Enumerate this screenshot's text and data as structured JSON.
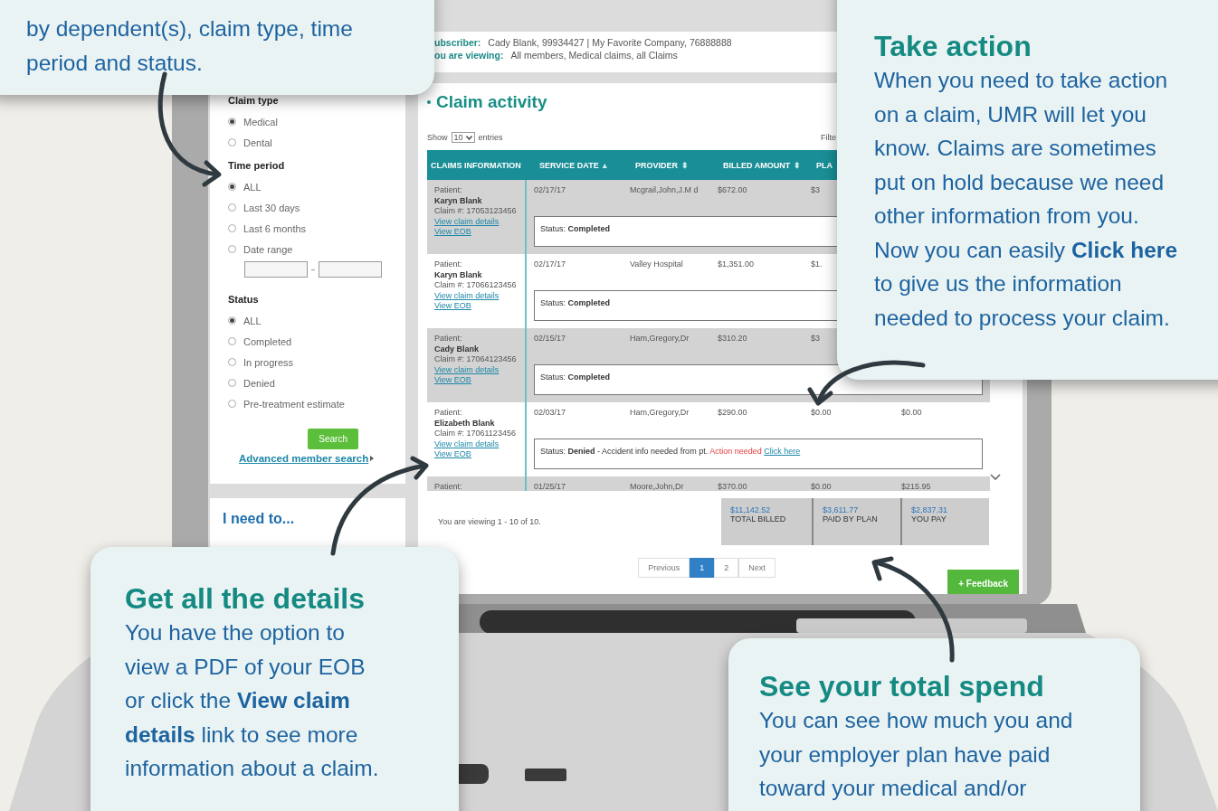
{
  "intro_callout": {
    "lines": [
      "by dependent(s), claim type, time",
      "period and status."
    ]
  },
  "sidebar": {
    "groups": [
      {
        "title": "Claim type",
        "options": [
          {
            "label": "Medical",
            "selected": true
          },
          {
            "label": "Dental",
            "selected": false
          }
        ]
      },
      {
        "title": "Time period",
        "options": [
          {
            "label": "ALL",
            "selected": true
          },
          {
            "label": "Last 30 days",
            "selected": false
          },
          {
            "label": "Last 6 months",
            "selected": false
          },
          {
            "label": "Date range",
            "selected": false
          }
        ],
        "date_fields": true
      },
      {
        "title": "Status",
        "options": [
          {
            "label": "ALL",
            "selected": true
          },
          {
            "label": "Completed",
            "selected": false
          },
          {
            "label": "In progress",
            "selected": false
          },
          {
            "label": "Denied",
            "selected": false
          },
          {
            "label": "Pre-treatment estimate",
            "selected": false
          }
        ]
      }
    ],
    "search_button": "Search",
    "advanced_link": "Advanced member search",
    "need_title": "I need to..."
  },
  "main": {
    "subscriber": {
      "label": "ubscriber:",
      "value": "Cady Blank, 99934427 | My Favorite Company, 76888888"
    },
    "viewing": {
      "label": "ou are viewing:",
      "value": "All members, Medical claims, all Claims"
    },
    "title": "Claim activity",
    "show": "Show",
    "page_size": "10",
    "entries": "entries",
    "filter": "Filte",
    "columns": [
      {
        "label": "CLAIMS INFORMATION"
      },
      {
        "label": "SERVICE DATE",
        "sort_icon": "▴"
      },
      {
        "label": "PROVIDER",
        "sort_icon": "⬍"
      },
      {
        "label": "BILLED AMOUNT",
        "sort_icon": "⬍"
      },
      {
        "label": "PLA"
      }
    ],
    "rows": [
      {
        "patient_label": "Patient:",
        "patient": "Karyn Blank",
        "claim": "Claim #: 17053123456",
        "details_link": "View claim details",
        "eob_link": "View EOB",
        "date": "02/17/17",
        "provider": "Mcgrail,John,J.M d",
        "billed": "$672.00",
        "plan_paid": "$3",
        "status_label": "Status:",
        "status": "Completed",
        "shaded": true
      },
      {
        "patient_label": "Patient:",
        "patient": "Karyn Blank",
        "claim": "Claim #: 17066123456",
        "details_link": "View claim details",
        "eob_link": "View EOB",
        "date": "02/17/17",
        "provider": "Valley Hospital",
        "billed": "$1,351.00",
        "plan_paid": "$1.",
        "status_label": "Status:",
        "status": "Completed",
        "shaded": false
      },
      {
        "patient_label": "Patient:",
        "patient": "Cady Blank",
        "claim": "Claim #: 17064123456",
        "details_link": "View claim details",
        "eob_link": "View EOB",
        "date": "02/15/17",
        "provider": "Ham,Gregory,Dr",
        "billed": "$310.20",
        "plan_paid": "$3",
        "status_label": "Status:",
        "status": "Completed",
        "shaded": true
      },
      {
        "patient_label": "Patient:",
        "patient": "Elizabeth Blank",
        "claim": "Claim #: 17061123456",
        "details_link": "View claim details",
        "eob_link": "View EOB",
        "date": "02/03/17",
        "provider": "Ham,Gregory,Dr",
        "billed": "$290.00",
        "plan_paid": "$0.00",
        "you_pay": "$0.00",
        "status_label": "Status:",
        "status": "Denied",
        "note": "- Accident info needed from pt.",
        "action": "Action needed",
        "action_link": "Click here",
        "shaded": false
      },
      {
        "patient_label": "Patient:",
        "date": "01/25/17",
        "provider": "Moore,John,Dr",
        "billed": "$370.00",
        "plan_paid": "$0.00",
        "you_pay": "$215.95",
        "shaded": true
      }
    ],
    "viewing_count": "You are viewing 1 - 10 of 10.",
    "totals": [
      {
        "amount": "$11,142.52",
        "label": "TOTAL BILLED"
      },
      {
        "amount": "$3,611.77",
        "label": "PAID BY PLAN"
      },
      {
        "amount": "$2,837.31",
        "label": "YOU PAY"
      }
    ],
    "pagination": [
      {
        "label": "Previous",
        "selected": false
      },
      {
        "label": "1",
        "selected": true
      },
      {
        "label": "2",
        "selected": false
      },
      {
        "label": "Next",
        "selected": false
      }
    ],
    "feedback": "+ Feedback"
  },
  "callouts": [
    {
      "title": "Take action",
      "lines": [
        "When you need to take action",
        "on a claim, UMR will let you",
        "know. Claims are sometimes",
        "put on hold because we need",
        "other information from you.",
        "Now you can easily **Click here**",
        "to give us the information",
        "needed to process your claim."
      ]
    },
    {
      "title": "Get all the details",
      "lines": [
        "You have the option to",
        "view a PDF of your EOB",
        "or click the **View claim**",
        "**details** link to see more",
        "information about a claim."
      ]
    },
    {
      "title": "See your total spend",
      "lines": [
        "You can see how much you and",
        "your employer plan have paid",
        "toward your medical and/or"
      ]
    }
  ]
}
